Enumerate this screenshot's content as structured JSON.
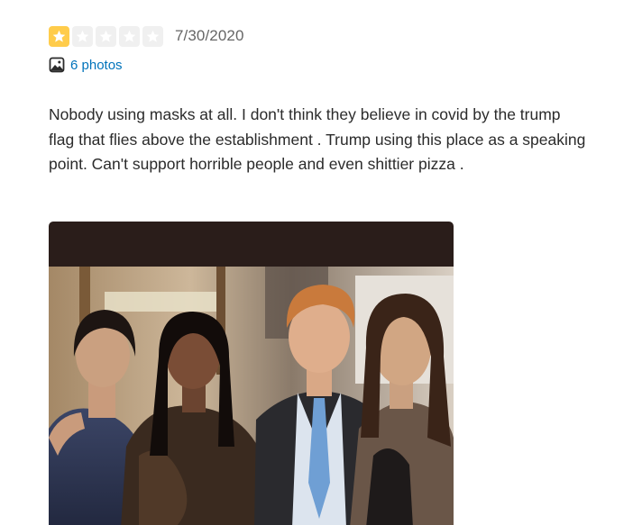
{
  "review": {
    "rating": 1,
    "rating_max": 5,
    "date": "7/30/2020",
    "photos_label": "6 photos",
    "text": "Nobody using masks at all. I don't think they believe in covid by the trump flag that flies above the establishment . Trump using this place as a speaking point. Can't support horrible people and even shittier pizza .",
    "photo_icon": "image-icon",
    "star_icon": "star-icon",
    "colors": {
      "star_filled": "#ffcc4b",
      "star_empty": "#f0f0f0",
      "link": "#0073bb",
      "date": "#666666",
      "text": "#2b2b2b"
    }
  }
}
